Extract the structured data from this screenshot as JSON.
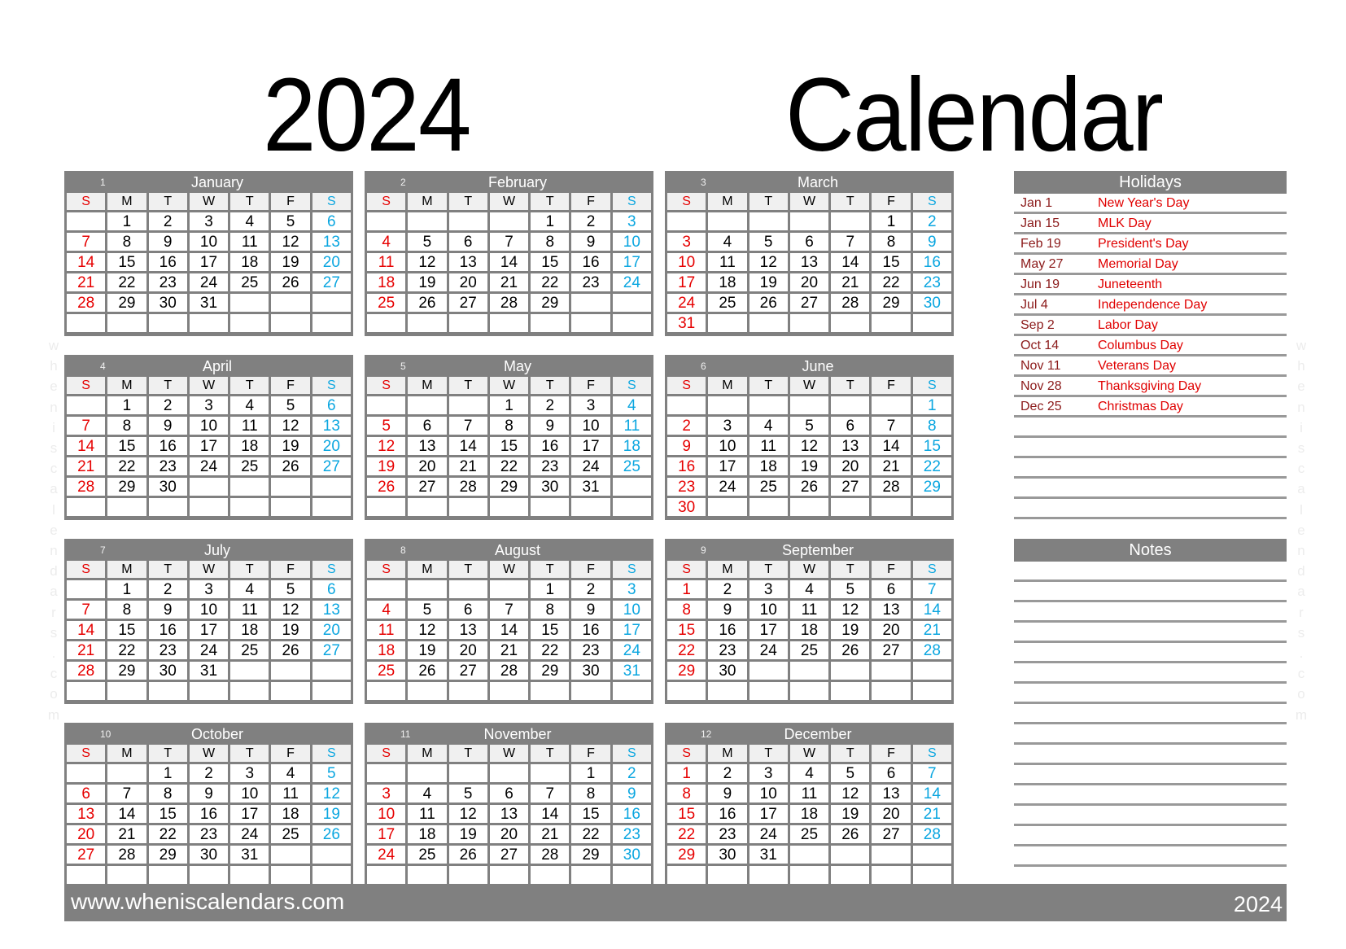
{
  "title": {
    "year": "2024",
    "word": "Calendar"
  },
  "watermark": "wheniscalendars.com",
  "weekdays": [
    "S",
    "M",
    "T",
    "W",
    "T",
    "F",
    "S"
  ],
  "months": [
    {
      "num": "1",
      "name": "January",
      "start": 1,
      "days": 31
    },
    {
      "num": "2",
      "name": "February",
      "start": 4,
      "days": 29
    },
    {
      "num": "3",
      "name": "March",
      "start": 5,
      "days": 31
    },
    {
      "num": "4",
      "name": "April",
      "start": 1,
      "days": 30
    },
    {
      "num": "5",
      "name": "May",
      "start": 3,
      "days": 31
    },
    {
      "num": "6",
      "name": "June",
      "start": 6,
      "days": 30
    },
    {
      "num": "7",
      "name": "July",
      "start": 1,
      "days": 31
    },
    {
      "num": "8",
      "name": "August",
      "start": 4,
      "days": 31
    },
    {
      "num": "9",
      "name": "September",
      "start": 0,
      "days": 30
    },
    {
      "num": "10",
      "name": "October",
      "start": 2,
      "days": 31
    },
    {
      "num": "11",
      "name": "November",
      "start": 5,
      "days": 30
    },
    {
      "num": "12",
      "name": "December",
      "start": 0,
      "days": 31
    }
  ],
  "holidays": {
    "title": "Holidays",
    "items": [
      {
        "date": "Jan 1",
        "name": "New Year's Day"
      },
      {
        "date": "Jan 15",
        "name": "MLK Day"
      },
      {
        "date": "Feb 19",
        "name": "President's Day"
      },
      {
        "date": "May 27",
        "name": "Memorial Day"
      },
      {
        "date": "Jun 19",
        "name": "Juneteenth"
      },
      {
        "date": "Jul 4",
        "name": "Independence Day"
      },
      {
        "date": "Sep 2",
        "name": "Labor Day"
      },
      {
        "date": "Oct 14",
        "name": "Columbus Day"
      },
      {
        "date": "Nov 11",
        "name": "Veterans Day"
      },
      {
        "date": "Nov 28",
        "name": "Thanksgiving Day"
      },
      {
        "date": "Dec 25",
        "name": "Christmas Day"
      }
    ],
    "blank_lines": 5
  },
  "notes": {
    "title": "Notes",
    "blank_lines": 17
  },
  "footer": {
    "url": "www.wheniscalendars.com",
    "year": "2024"
  },
  "colors": {
    "sunday": "#e60000",
    "saturday": "#0aa6e0",
    "header_gray": "#808080"
  }
}
